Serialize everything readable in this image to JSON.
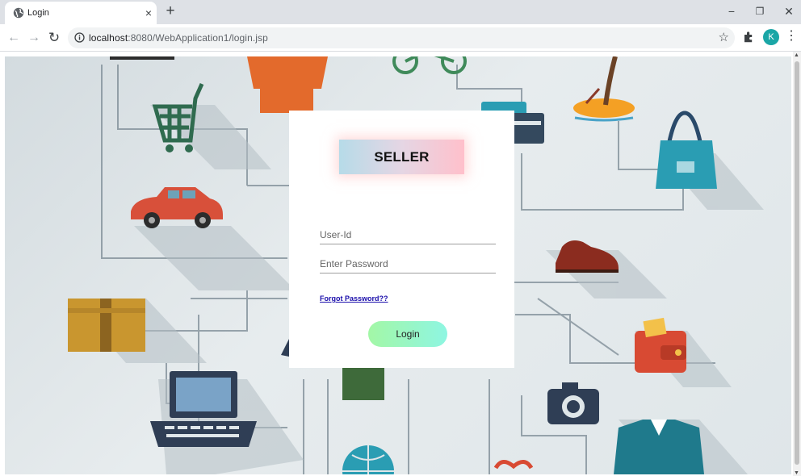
{
  "browser": {
    "tab_title": "Login",
    "tab_close": "×",
    "new_tab": "+",
    "url_host": "localhost",
    "url_path": ":8080/WebApplication1/login.jsp",
    "profile_initial": "K",
    "window_controls": {
      "minimize": "−",
      "restore": "❐",
      "close": "✕"
    },
    "icons": [
      "globe-icon",
      "back-icon",
      "forward-icon",
      "reload-icon",
      "info-icon",
      "star-icon",
      "extensions-icon",
      "menu-icon"
    ]
  },
  "login": {
    "heading": "SELLER",
    "userid_placeholder": "User-Id",
    "password_placeholder": "Enter Password",
    "forgot_label": "Forgot Password??",
    "login_label": "Login"
  },
  "colors": {
    "heading_gradient": [
      "#b6dbe8",
      "#ffc0cb"
    ],
    "button_gradient": [
      "#a3f7a6",
      "#8ef6e2"
    ],
    "link": "#1a0dab",
    "profile": "#1aa6a6"
  }
}
